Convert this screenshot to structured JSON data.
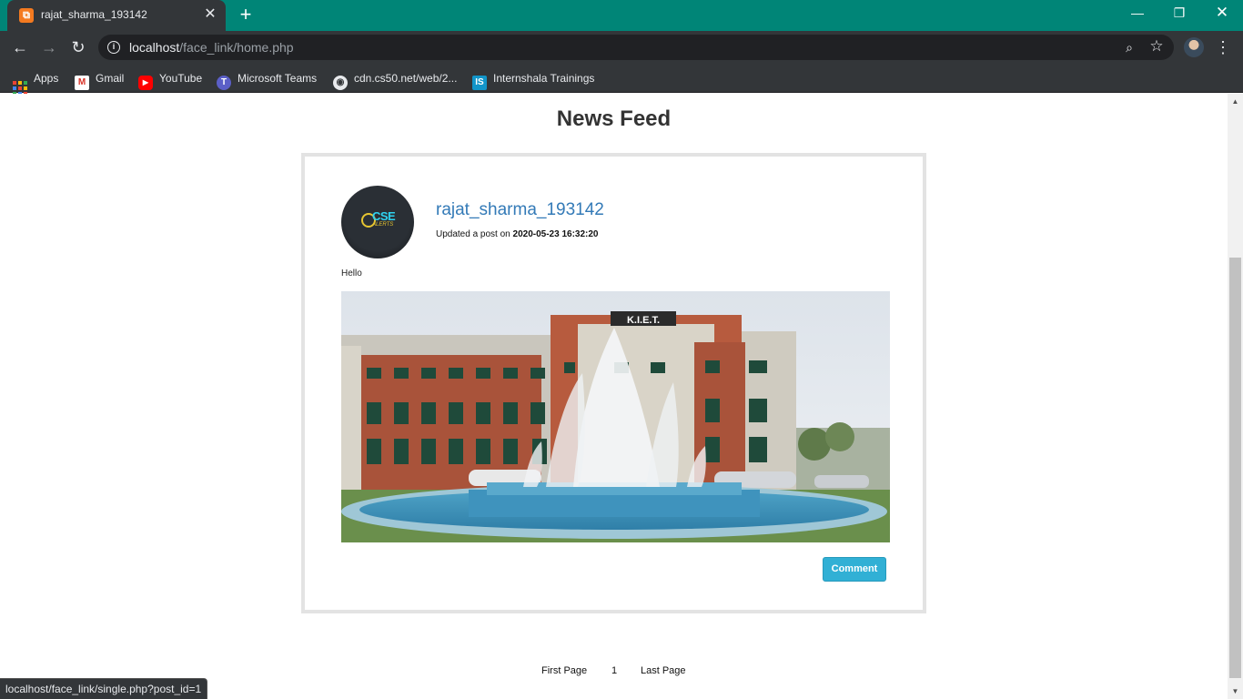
{
  "browser": {
    "tab_title": "rajat_sharma_193142",
    "tab_favicon_glyph": "⧉",
    "url_host": "localhost",
    "url_path": "/face_link/home.php",
    "close_glyph": "✕",
    "new_tab_glyph": "+",
    "min_glyph": "—",
    "max_glyph": "❐",
    "win_close_glyph": "✕",
    "back_glyph": "←",
    "forward_glyph": "→",
    "reload_glyph": "↻",
    "info_glyph": "i",
    "zoom_glyph": "⌕",
    "star_glyph": "☆",
    "menu_glyph": "⋮",
    "status_url": "localhost/face_link/single.php?post_id=1",
    "colors": {
      "frame": "#008577",
      "toolbar": "#333639"
    }
  },
  "bookmarks": [
    {
      "label": "Apps",
      "icon": "apps-icon"
    },
    {
      "label": "Gmail",
      "icon": "gmail-icon"
    },
    {
      "label": "YouTube",
      "icon": "youtube-icon"
    },
    {
      "label": "Microsoft Teams",
      "icon": "teams-icon"
    },
    {
      "label": "cdn.cs50.net/web/2...",
      "icon": "globe-icon"
    },
    {
      "label": "Internshala Trainings",
      "icon": "internshala-icon"
    }
  ],
  "page": {
    "title": "News Feed"
  },
  "post": {
    "author": "rajat_sharma_193142",
    "meta_prefix": "Updated a post on ",
    "timestamp": "2020-05-23 16:32:20",
    "text": "Hello",
    "image_sign": "K.I.E.T.",
    "comment_label": "Comment",
    "avatar_brand": "CSE",
    "avatar_sub": "ALERTS"
  },
  "pagination": {
    "first": "First Page",
    "current": "1",
    "last": "Last Page"
  }
}
